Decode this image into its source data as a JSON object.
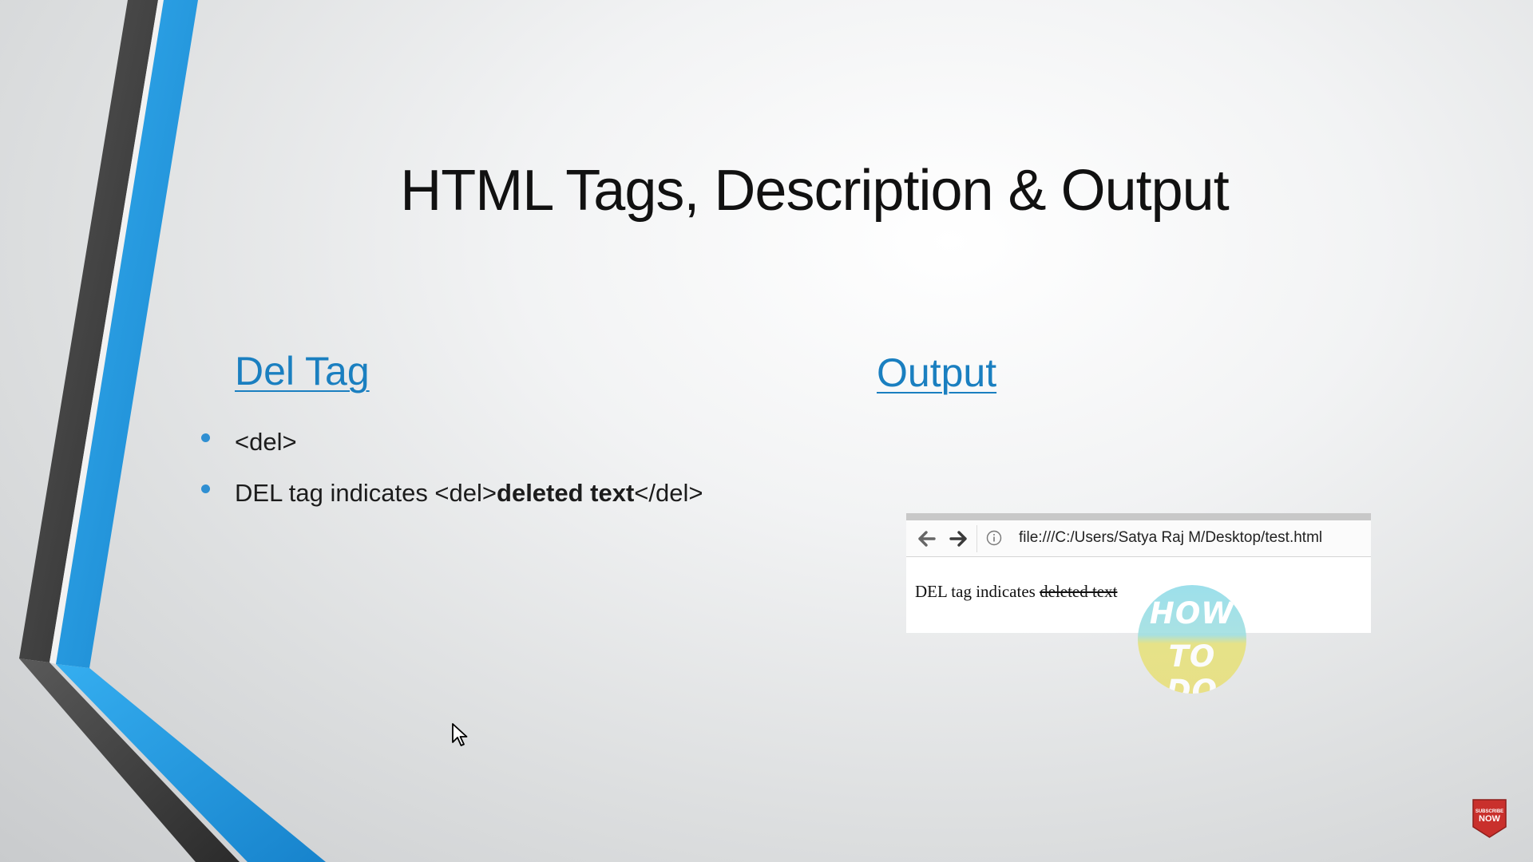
{
  "slide": {
    "title": "HTML Tags, Description & Output",
    "left_heading": "Del Tag",
    "right_heading": "Output",
    "bullets": [
      {
        "parts": [
          "<del>"
        ]
      },
      {
        "parts": [
          "DEL tag indicates <del>",
          "deleted text",
          "</del>"
        ]
      }
    ]
  },
  "browser": {
    "url": "file:///C:/Users/Satya Raj M/Desktop/test.html",
    "content_plain": "DEL tag indicates",
    "content_deleted": "deleted text",
    "icons": [
      "back-arrow-icon",
      "forward-arrow-icon",
      "info-icon"
    ]
  },
  "watermark": {
    "line1": "HOW",
    "line2": "TO DO"
  },
  "subscribe_badge": {
    "top": "SUBSCRIBE",
    "bottom": "NOW"
  },
  "colors": {
    "accent_blue": "#1a7fc0",
    "stripe_blue": "#2a9fe6",
    "stripe_dark": "#3d3d3d",
    "badge_red": "#c9302c"
  }
}
